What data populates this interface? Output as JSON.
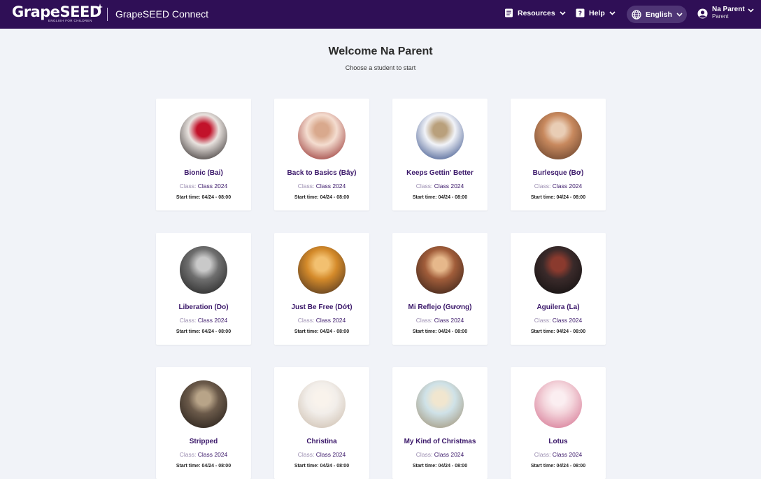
{
  "header": {
    "logo_text": "GrapeSEED",
    "logo_tagline": "ENGLISH FOR CHILDREN",
    "app_name": "GrapeSEED Connect",
    "resources_label": "Resources",
    "help_label": "Help",
    "language_label": "English",
    "user_name": "Na Parent",
    "user_role": "Parent"
  },
  "main": {
    "title": "Welcome Na Parent",
    "subtitle": "Choose a student to start",
    "class_label": "Class:",
    "time_label": "Start time:"
  },
  "students": [
    {
      "name": "Bionic (Bai)",
      "class": "Class 2024",
      "start": "04/24 - 08:00",
      "c1": "#e9e3df",
      "c2": "#1a1414",
      "c3": "#c2122a"
    },
    {
      "name": "Back to Basics (Bây)",
      "class": "Class 2024",
      "start": "04/24 - 08:00",
      "c1": "#f4ddd0",
      "c2": "#8a1b1b",
      "c3": "#d9a98d"
    },
    {
      "name": "Keeps Gettin' Better",
      "class": "Class 2024",
      "start": "04/24 - 08:00",
      "c1": "#f1f3f8",
      "c2": "#1f3a7a",
      "c3": "#b9a07c"
    },
    {
      "name": "Burlesque (Bơ)",
      "class": "Class 2024",
      "start": "04/24 - 08:00",
      "c1": "#c8895e",
      "c2": "#5a3825",
      "c3": "#e9cdb5"
    },
    {
      "name": "Liberation (Do)",
      "class": "Class 2024",
      "start": "04/24 - 08:00",
      "c1": "#6f6f6f",
      "c2": "#1b1b1b",
      "c3": "#c9c9c9"
    },
    {
      "name": "Just Be Free (Dớt)",
      "class": "Class 2024",
      "start": "04/24 - 08:00",
      "c1": "#d48a2a",
      "c2": "#3c2a20",
      "c3": "#f2c070"
    },
    {
      "name": "Mi Reflejo (Gương)",
      "class": "Class 2024",
      "start": "04/24 - 08:00",
      "c1": "#a15d3a",
      "c2": "#2a1a14",
      "c3": "#e6b88b"
    },
    {
      "name": "Aguilera (La)",
      "class": "Class 2024",
      "start": "04/24 - 08:00",
      "c1": "#3a2a2a",
      "c2": "#0d0d0d",
      "c3": "#8a3a2e"
    },
    {
      "name": "Stripped",
      "class": "Class 2024",
      "start": "04/24 - 08:00",
      "c1": "#6b5a4a",
      "c2": "#1d1713",
      "c3": "#b8a488"
    },
    {
      "name": "Christina",
      "class": "Class 2024",
      "start": "04/24 - 08:00",
      "c1": "#f2eeea",
      "c2": "#c9b9a8",
      "c3": "#f9f3ec"
    },
    {
      "name": "My Kind of Christmas",
      "class": "Class 2024",
      "start": "04/24 - 08:00",
      "c1": "#cfe2e8",
      "c2": "#9b8a6a",
      "c3": "#f1e6cf"
    },
    {
      "name": "Lotus",
      "class": "Class 2024",
      "start": "04/24 - 08:00",
      "c1": "#f3d3da",
      "c2": "#d26a8a",
      "c3": "#fbeef1"
    }
  ]
}
